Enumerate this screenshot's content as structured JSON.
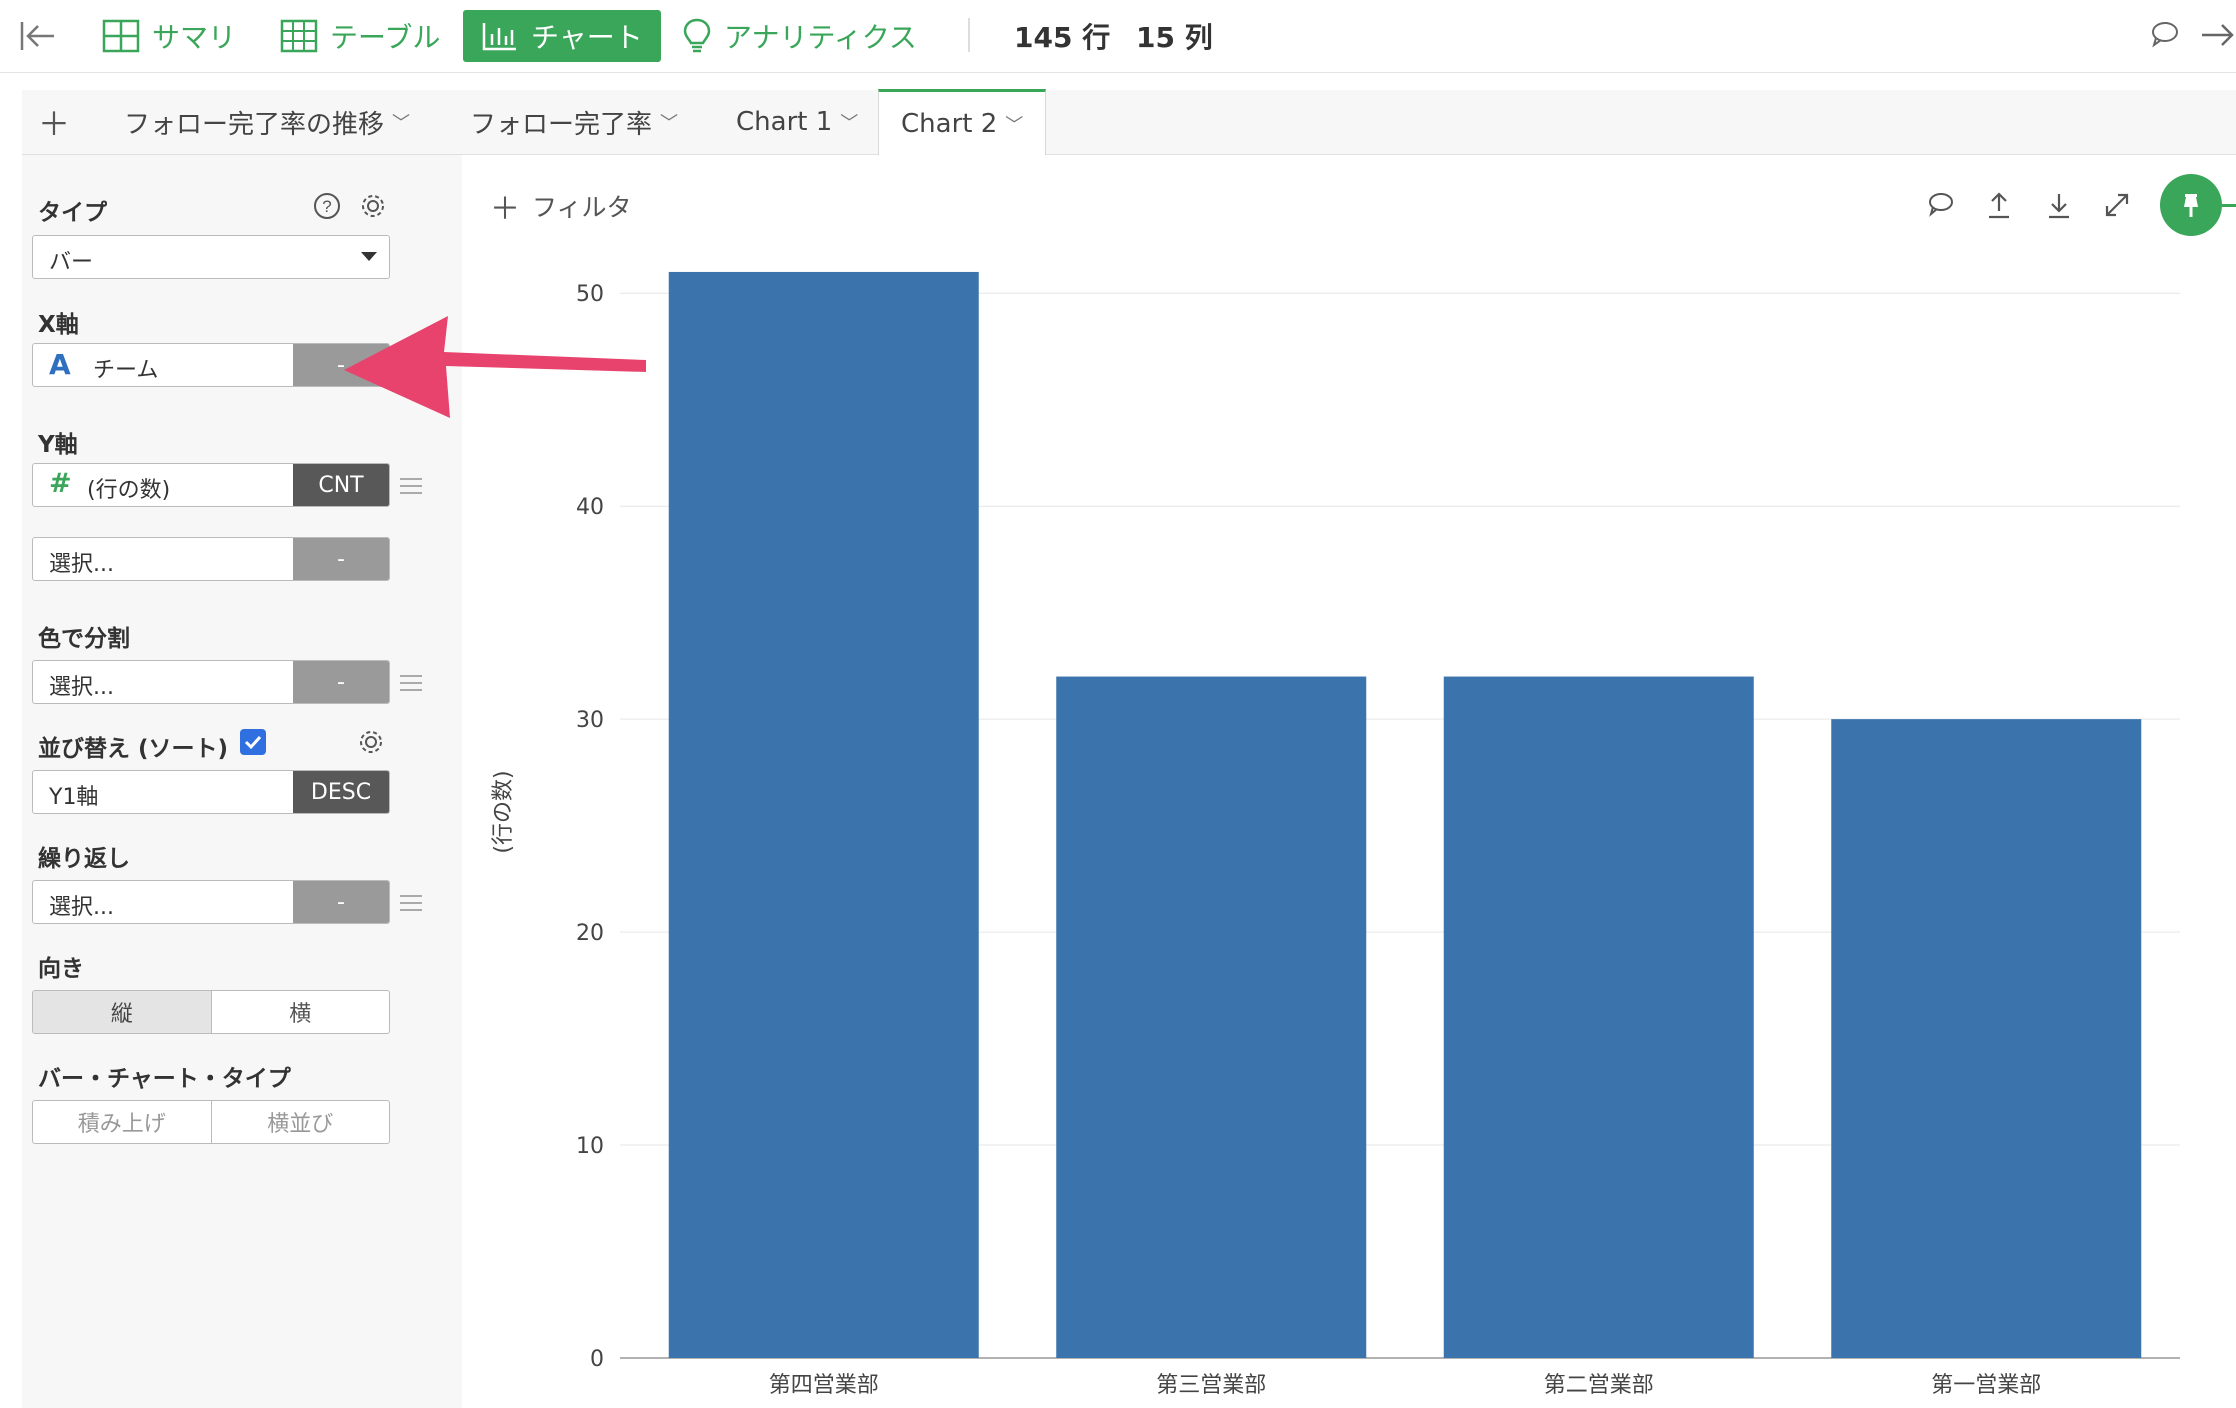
{
  "toolbar": {
    "summary": "サマリ",
    "table": "テーブル",
    "chart": "チャート",
    "analytics": "アナリティクス",
    "rows": "145 行",
    "cols": "15 列"
  },
  "tabs": [
    {
      "label": "フォロー完了率の推移"
    },
    {
      "label": "フォロー完了率"
    },
    {
      "label": "Chart 1"
    },
    {
      "label": "Chart 2"
    }
  ],
  "panel": {
    "type_label": "タイプ",
    "type_value": "バー",
    "x_label": "X軸",
    "x_value": "チーム",
    "x_btn": "-",
    "y_label": "Y軸",
    "y_value": "(行の数)",
    "y_btn": "CNT",
    "y2_value": "選択...",
    "y2_btn": "-",
    "color_label": "色で分割",
    "color_value": "選択...",
    "color_btn": "-",
    "sort_label": "並び替え (ソート)",
    "sort_value": "Y1軸",
    "sort_btn": "DESC",
    "repeat_label": "繰り返し",
    "repeat_value": "選択...",
    "repeat_btn": "-",
    "orient_label": "向き",
    "orient_options": [
      "縦",
      "横"
    ],
    "bartype_label": "バー・チャート・タイプ",
    "bartype_options": [
      "積み上げ",
      "横並び"
    ]
  },
  "filter_label": "フィルタ",
  "colors": {
    "accent": "#3aa65a",
    "bar": "#3b74ad",
    "arrow": "#e8436c"
  },
  "chart_data": {
    "type": "bar",
    "categories": [
      "第四営業部",
      "第三営業部",
      "第二営業部",
      "第一営業部"
    ],
    "values": [
      51,
      32,
      32,
      30
    ],
    "ylabel": "(行の数)",
    "xlabel": "",
    "ylim": [
      0,
      52.5
    ],
    "yticks": [
      0,
      10,
      20,
      30,
      40,
      50
    ],
    "grid": true
  }
}
